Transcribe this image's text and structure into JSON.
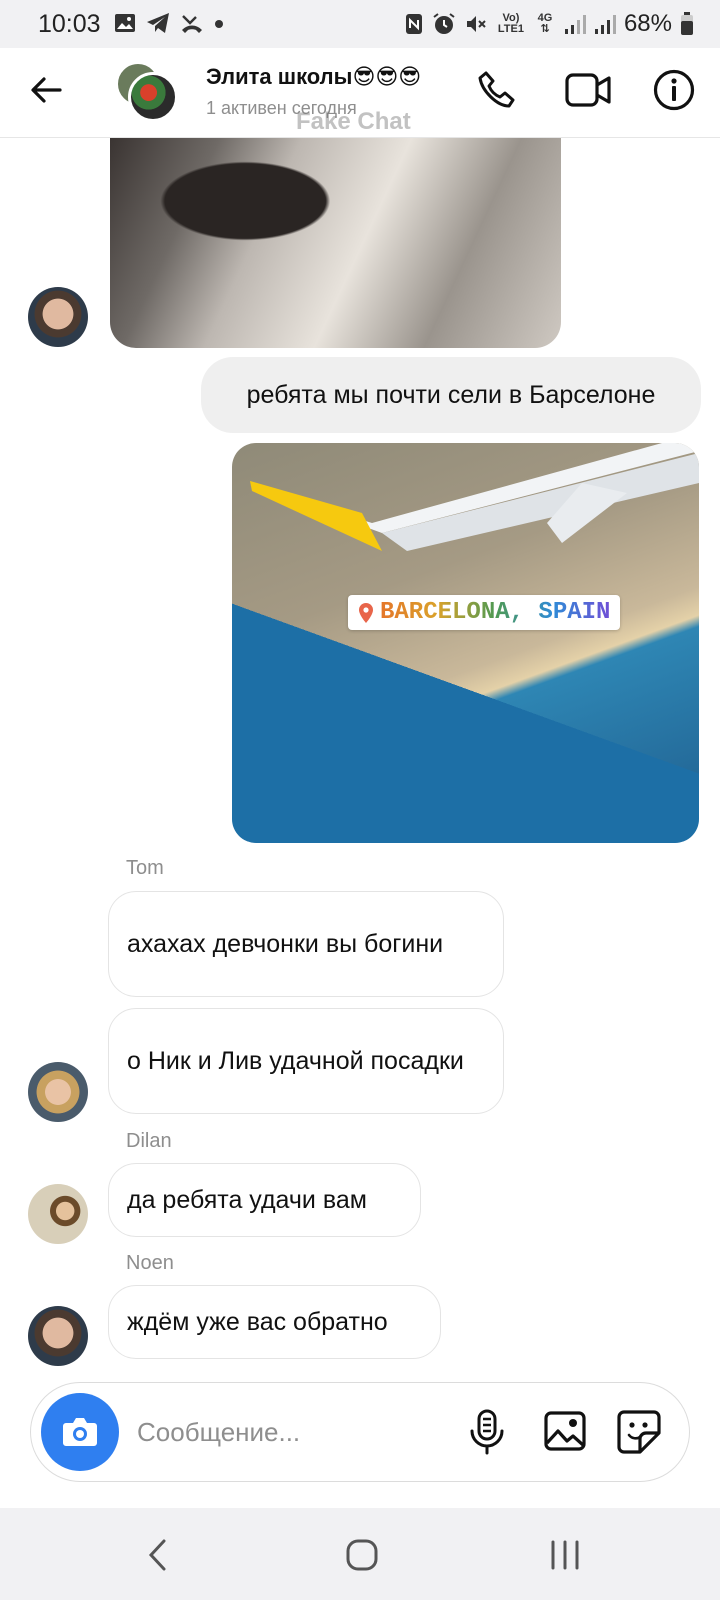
{
  "status_bar": {
    "time": "10:03",
    "battery": "68%",
    "network": "4G",
    "volte": "Vo) LTE1",
    "left_icons": [
      "image-icon",
      "telegram-icon",
      "missed-call-icon",
      "dot-icon"
    ],
    "right_icons": [
      "nfc-icon",
      "alarm-icon",
      "mute-icon",
      "volte-icon",
      "4g-icon",
      "signal-icon",
      "signal-icon",
      "battery-icon"
    ]
  },
  "header": {
    "title": "Элита школы😎😎😎",
    "subtitle": "1 активен сегодня",
    "watermark": "Fake Chat",
    "icons": [
      "back-arrow-icon",
      "phone-icon",
      "video-call-icon",
      "info-icon"
    ]
  },
  "chat": {
    "sent_text": "ребята мы почти сели в Барселоне",
    "location_tag": "BARCELONA, SPAIN",
    "groups": [
      {
        "sender": "Tom",
        "messages": [
          "ахахах девчонки вы богини",
          "о Ник и Лив удачной посадки"
        ]
      },
      {
        "sender": "Dilan",
        "messages": [
          "да ребята удачи вам"
        ]
      },
      {
        "sender": "Noen",
        "messages": [
          "ждём уже вас обратно"
        ]
      }
    ]
  },
  "composer": {
    "placeholder": "Сообщение...",
    "icons": [
      "camera-icon",
      "microphone-icon",
      "gallery-icon",
      "sticker-icon"
    ]
  },
  "nav_bar": {
    "icons": [
      "nav-back-icon",
      "nav-home-icon",
      "nav-recents-icon"
    ]
  }
}
